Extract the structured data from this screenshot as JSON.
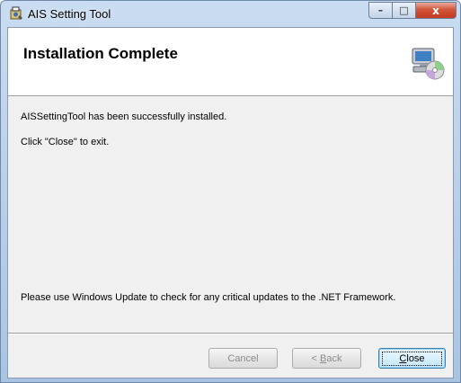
{
  "window": {
    "title": "AIS Setting Tool",
    "app_icon": "installer-icon",
    "caption": {
      "minimize_glyph": "–",
      "maximize_glyph": "□",
      "close_glyph": "x"
    }
  },
  "banner": {
    "title": "Installation Complete",
    "icon": "computer-cd-icon"
  },
  "body": {
    "message_installed": "AISSettingTool has been successfully installed.",
    "message_close": "Click \"Close\" to exit.",
    "message_update": "Please use Windows Update to check for any critical updates to the .NET Framework."
  },
  "buttons": {
    "cancel_label": "Cancel",
    "back_prefix": "< ",
    "back_mnemonic": "B",
    "back_rest": "ack",
    "close_mnemonic": "C",
    "close_rest": "lose"
  },
  "colors": {
    "titlebar": "#b9d1ea",
    "client_background": "#f0f0f0",
    "close_button": "#c7472e"
  }
}
